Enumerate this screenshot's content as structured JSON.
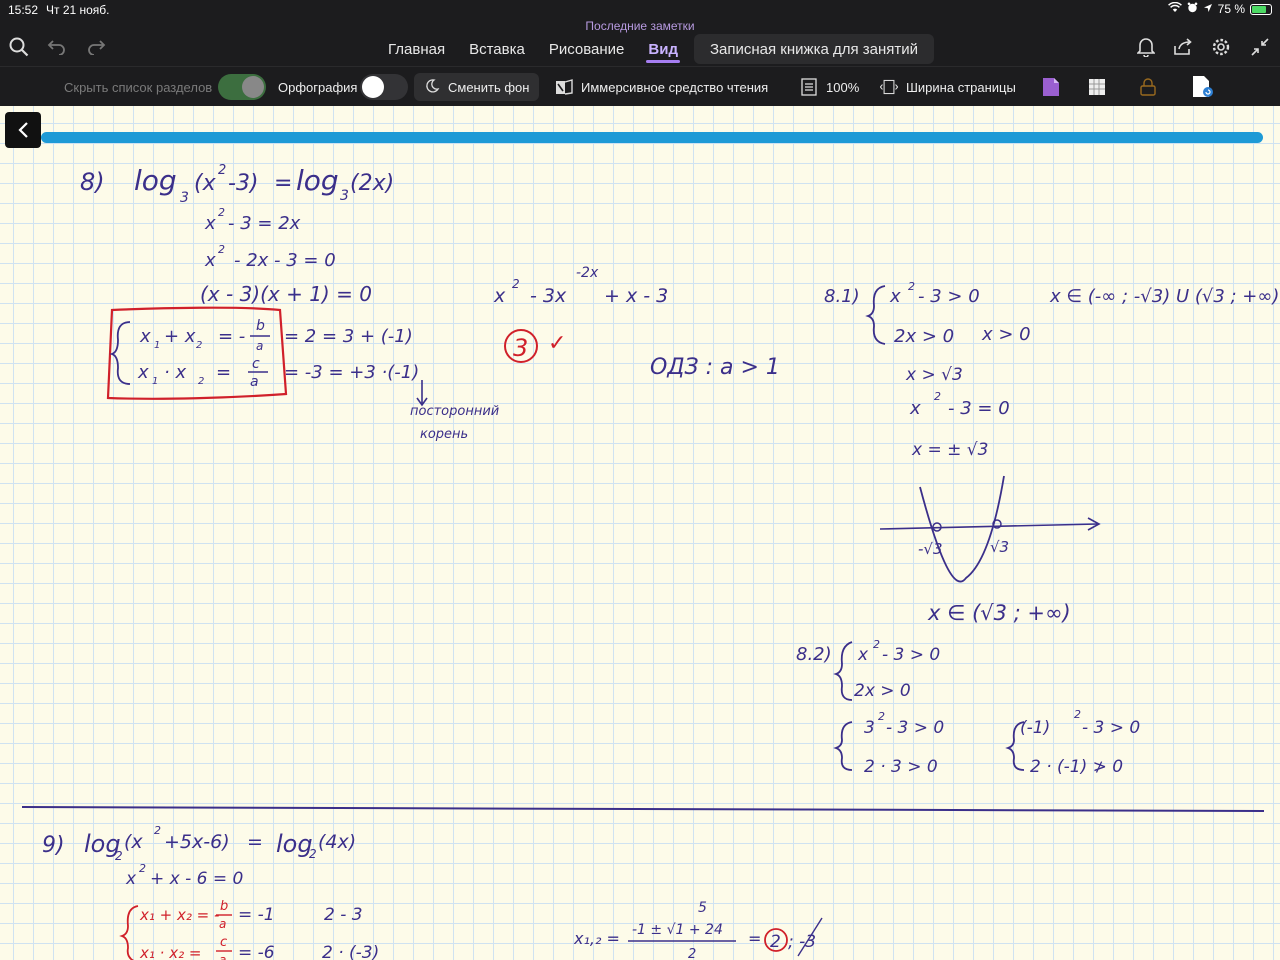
{
  "status_bar": {
    "time": "15:52",
    "date": "Чт 21 нояб.",
    "battery": "75 %",
    "battery_level": 0.75
  },
  "app": {
    "breadcrumb": "Последние заметки"
  },
  "tabs": [
    {
      "label": "Главная"
    },
    {
      "label": "Вставка"
    },
    {
      "label": "Рисование"
    },
    {
      "label": "Вид"
    },
    {
      "label": "Записная книжка для занятий"
    }
  ],
  "ribbon": {
    "hide_sections": "Скрыть список разделов",
    "spelling": "Орфография",
    "change_bg": "Сменить фон",
    "immersive": "Иммерсивное средство чтения",
    "zoom": "100%",
    "page_width": "Ширина страницы"
  },
  "colors": {
    "accent": "#a67ef2",
    "ink": "#3b2f8a",
    "red_ink": "#d0202a",
    "bar": "#1e9ad6",
    "paper": "#fdfbe9"
  },
  "note": {
    "task8": {
      "title_num": "8)",
      "log1": "log",
      "base1": "3",
      "arg1": "(x",
      "exp1": "2",
      "arg1b": "-3)",
      "eq": "=",
      "log2": "log",
      "base2": "3",
      "arg2": "(2x)",
      "l1a": "x",
      "l1exp": "2",
      "l1b": "- 3 = 2x",
      "l2a": "x",
      "l2exp": "2",
      "l2b": "- 2x - 3 = 0",
      "l3": "(x - 3)(x + 1) = 0",
      "viet1": "x₁ + x₂ = - b/a = 2 = 3 + (-1)",
      "viet1a": "x",
      "viet1b": "1",
      "viet1c": "+ x",
      "viet1d": "2",
      "viet1e": "= -",
      "viet1f": "b",
      "viet1g": "a",
      "viet1h": "= 2 = 3 + (-1)",
      "viet2a": "x",
      "viet2b": "1",
      "viet2c": "· x",
      "viet2d": "2",
      "viet2e": "=",
      "viet2f": "c",
      "viet2g": "a",
      "viet2h": "= -3 = +3 ·(-1)",
      "extraneous1": "посторонний",
      "extraneous2": "корень",
      "mid_expr_a": "x",
      "mid_expr_b": "2",
      "mid_expr_c": "- 3x",
      "mid_expr_d": "-2x",
      "mid_expr_e": "+ x - 3",
      "answer": "3",
      "check": "✓",
      "odz": "ОДЗ : a > 1"
    },
    "task81": {
      "label": "8.1)",
      "s1a": "x",
      "s1b": "2",
      "s1c": "- 3 > 0",
      "s2": "2x > 0",
      "s2b": "x > 0",
      "set": "x ∈ (-∞ ; -√3) U (√3 ; +∞)",
      "r1": "x > √3",
      "r2a": "x",
      "r2b": "2",
      "r2c": "- 3 = 0",
      "r3": "x = ± √3",
      "pm_left": "-√3",
      "pm_right": "√3",
      "final": "x ∈ (√3 ; +∞)"
    },
    "task82": {
      "label": "8.2)",
      "s1a": "x",
      "s1b": "2",
      "s1c": "- 3 > 0",
      "s2": "2x > 0",
      "c1a": "3",
      "c1b": "2",
      "c1c": "- 3 > 0",
      "c2": "2 · 3 > 0",
      "d1a": "(-1)",
      "d1b": "2",
      "d1c": "- 3 > 0",
      "d2": "2 · (-1) ≯ 0"
    },
    "task9": {
      "title_num": "9)",
      "log1": "log",
      "base1": "2",
      "arg1a": "(x",
      "arg1b": "2",
      "arg1c": "+5x-6)",
      "eq": "=",
      "log2": "log",
      "base2": "2",
      "arg2": "(4x)",
      "l1a": "x",
      "l1b": "2",
      "l1c": "+ x - 6 = 0",
      "v1": "x₁ + x₂ = -",
      "v1f": "b",
      "v1g": "a",
      "v1h": "= -1",
      "v1i": "2 - 3",
      "v2": "x₁ · x₂ =",
      "v2f": "c",
      "v2g": "a",
      "v2h": "= -6",
      "v2i": "2 · (-3)",
      "root_lbl": "x₁,₂ =",
      "root_num": "-1 ± √1 + 24",
      "root_top": "5",
      "root_den": "2",
      "root_eq": "=",
      "root_ans": "2",
      "root_rest": "; -3"
    }
  }
}
